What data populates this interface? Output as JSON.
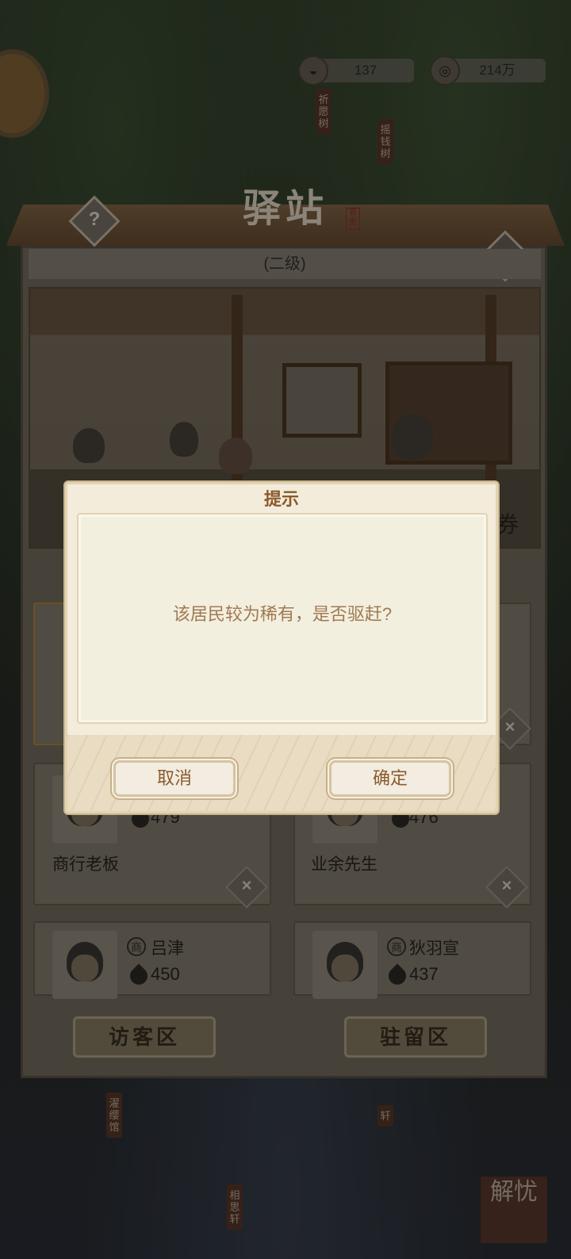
{
  "resources": {
    "silver": {
      "icon": "silver-ingot-icon",
      "value": "137"
    },
    "coins": {
      "icon": "copper-coin-icon",
      "value": "214万"
    }
  },
  "signs": {
    "wish_tree": "祈愿树",
    "money_tree": "摇钱树",
    "guanying": "濯缨馆",
    "xiangsi": "相思轩",
    "xuan": "轩"
  },
  "building": {
    "title": "驿站",
    "seal": "官吏",
    "level": "(二级)"
  },
  "residents": [
    {
      "name": "商行老板",
      "value": "479",
      "badge": ""
    },
    {
      "name": "业余先生",
      "value": "476",
      "badge": ""
    },
    {
      "name": "吕津",
      "value": "450",
      "badge": "商"
    },
    {
      "name": "狄羽宣",
      "value": "437",
      "badge": "商"
    }
  ],
  "partial_text": {
    "right_edge": "券"
  },
  "zone_buttons": {
    "visitor": "访客区",
    "resident": "驻留区"
  },
  "corner_button": "解忧",
  "modal": {
    "title": "提示",
    "message": "该居民较为稀有，是否驱赶?",
    "cancel": "取消",
    "confirm": "确定"
  },
  "colors": {
    "modal_title": "#8a5a2c",
    "modal_text": "#a07a52",
    "modal_bg": "#f3ecdb"
  }
}
